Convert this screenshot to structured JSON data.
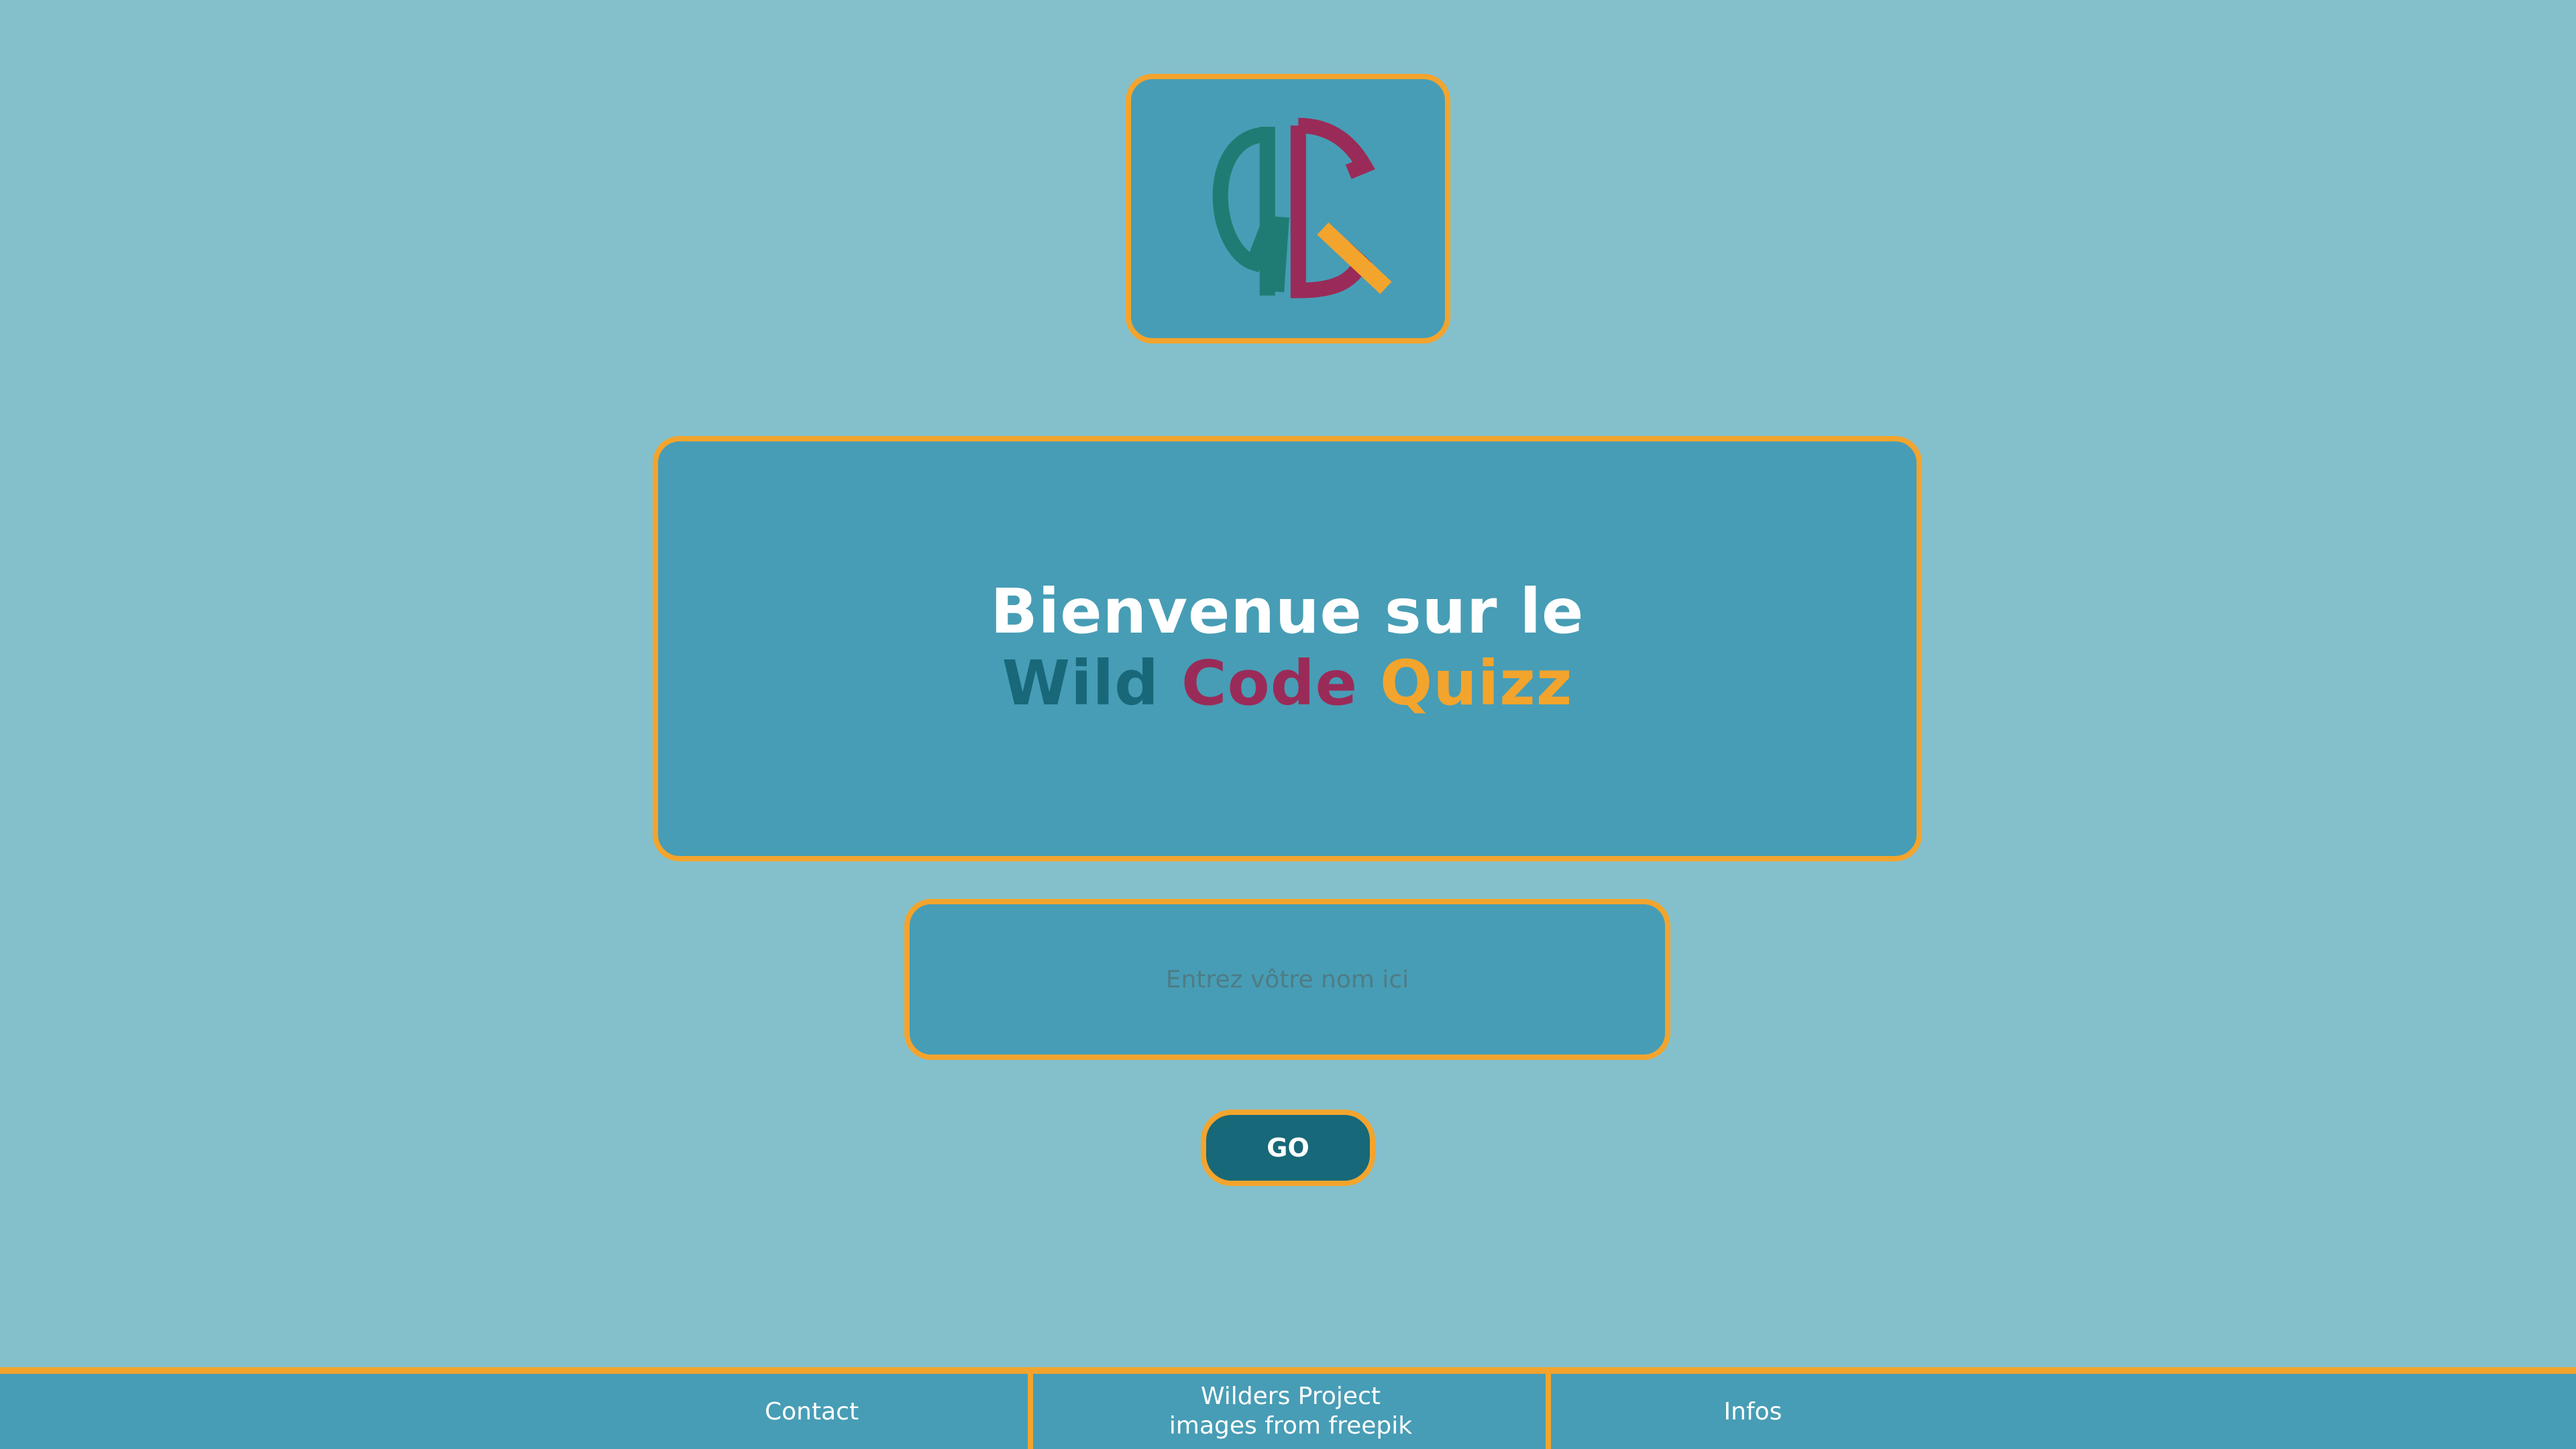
{
  "logo": {
    "letters": "WCQ",
    "colors": {
      "w": "#1f7c74",
      "c": "#9a2b58",
      "q": "#f3a42d"
    }
  },
  "hero": {
    "line1": "Bienvenue sur le",
    "line2_parts": {
      "wild": "Wild",
      "code": "Code",
      "quizz": "Quizz"
    }
  },
  "name_field": {
    "value": "",
    "placeholder": "Entrez vôtre nom ici"
  },
  "go_button": {
    "label": "GO"
  },
  "footer": {
    "contact": "Contact",
    "project_line1": "Wilders Project",
    "project_line2": "images from freepik",
    "infos": "Infos"
  },
  "theme": {
    "background": "#84c0cb",
    "panel": "#479db5",
    "border": "#f3a42d",
    "button": "#176878"
  }
}
